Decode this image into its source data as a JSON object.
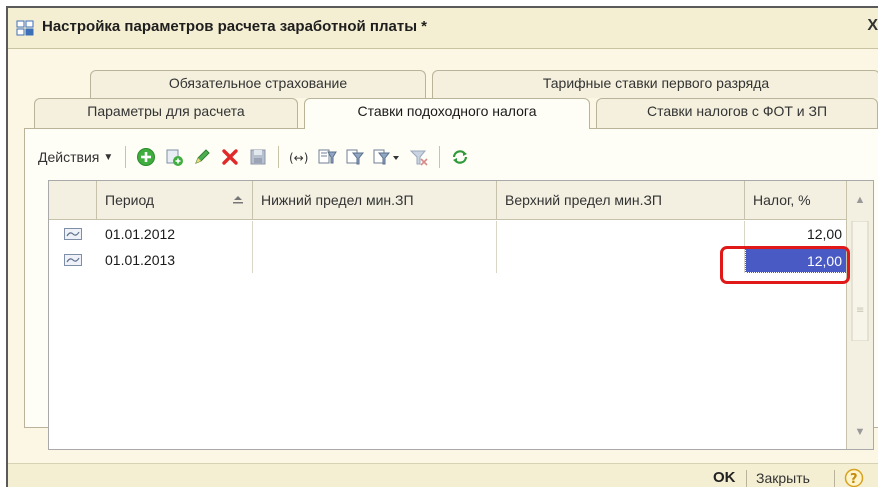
{
  "window": {
    "title": "Настройка параметров расчета заработной платы *",
    "close_glyph": "X"
  },
  "tabs": {
    "row1": [
      {
        "label": "Обязательное страхование"
      },
      {
        "label": "Тарифные ставки первого разряда"
      }
    ],
    "row2": [
      {
        "label": "Параметры для расчета"
      },
      {
        "label": "Ставки подоходного налога",
        "active": true
      },
      {
        "label": "Ставки налогов с ФОТ и ЗП"
      }
    ]
  },
  "toolbar": {
    "actions_label": "Действия",
    "icons": [
      "add-icon",
      "copy-icon",
      "edit-icon",
      "delete-icon",
      "save-icon",
      "range-icon",
      "filter-settings-icon",
      "filter-icon",
      "filter-dropdown-icon",
      "clear-filter-icon",
      "refresh-icon"
    ]
  },
  "table": {
    "columns": [
      "Период",
      "Нижний предел мин.ЗП",
      "Верхний предел мин.ЗП",
      "Налог, %"
    ],
    "rows": [
      {
        "period": "01.01.2012",
        "lower": "",
        "upper": "",
        "tax": "12,00"
      },
      {
        "period": "01.01.2013",
        "lower": "",
        "upper": "",
        "tax": "12,00"
      }
    ]
  },
  "footer": {
    "ok_label": "OK",
    "close_label": "Закрыть"
  },
  "colors": {
    "selection": "#4a5ac4",
    "highlight": "#e01818",
    "window_bg": "#fbf7e4"
  }
}
